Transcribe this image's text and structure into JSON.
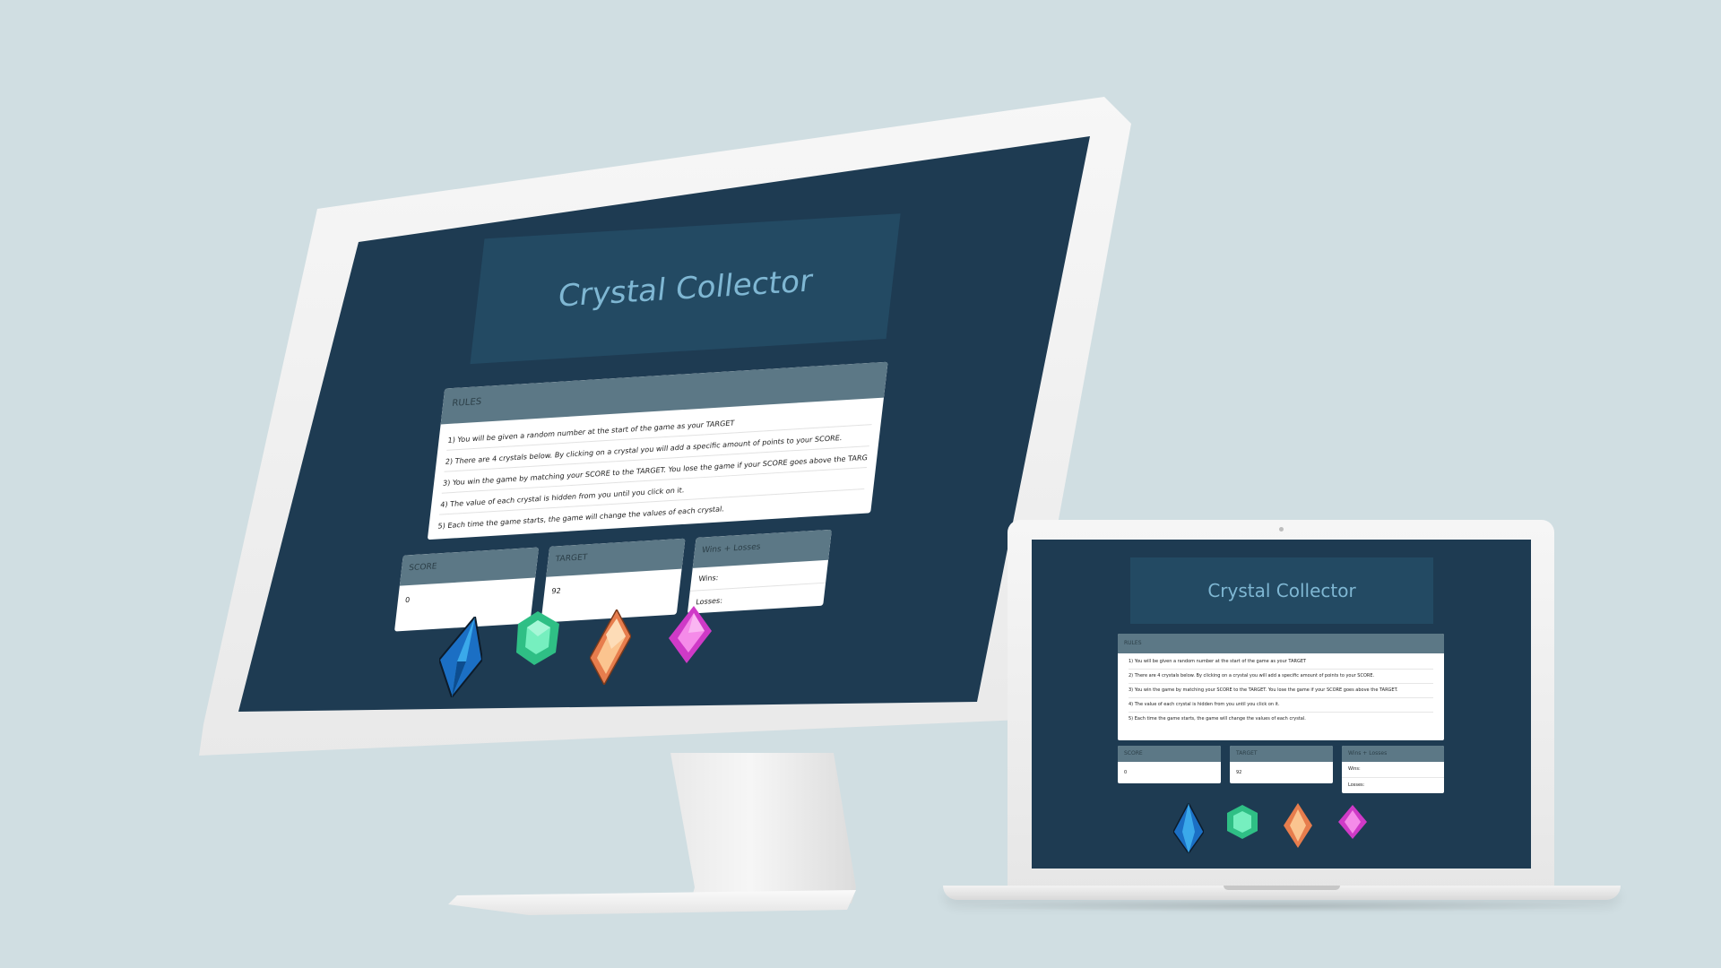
{
  "app": {
    "title": "Crystal Collector",
    "rules": {
      "heading": "RULES",
      "items": [
        "1) You will be given a random number at the start of the game as your TARGET",
        "2) There are 4 crystals below. By clicking on a crystal you will add a specific amount of points to your SCORE.",
        "3) You win the game by matching your SCORE to the TARGET. You lose the game if your SCORE goes above the TARGET.",
        "4) The value of each crystal is hidden from you until you click on it.",
        "5) Each time the game starts, the game will change the values of each crystal."
      ]
    },
    "score": {
      "heading": "SCORE",
      "value": "0"
    },
    "target": {
      "heading": "TARGET",
      "value": "92"
    },
    "record": {
      "heading": "Wins + Losses",
      "wins_label": "Wins:",
      "losses_label": "Losses:"
    },
    "crystals": [
      {
        "name": "blue-crystal-icon",
        "color": "#1a73c9"
      },
      {
        "name": "green-crystal-icon",
        "color": "#3fd69a"
      },
      {
        "name": "orange-crystal-icon",
        "color": "#f7a36c"
      },
      {
        "name": "pink-crystal-icon",
        "color": "#e04fd6"
      }
    ]
  },
  "colors": {
    "background": "#d0dee2",
    "screen": "#1e3b52",
    "jumbotron": "#234a63",
    "title_text": "#7fb7d3",
    "panel_header": "#5c7886"
  }
}
